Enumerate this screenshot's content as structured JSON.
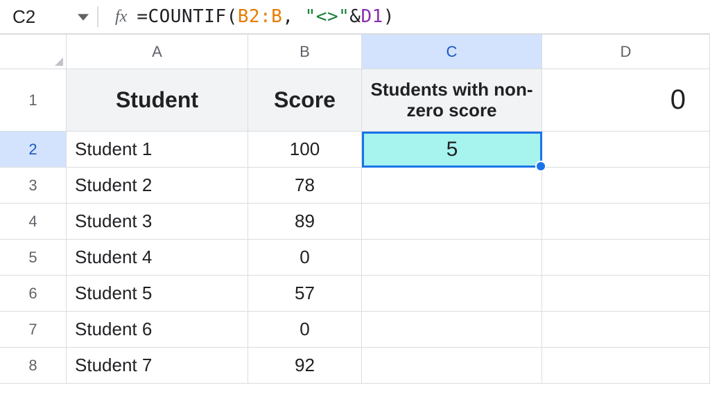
{
  "namebox": {
    "ref": "C2"
  },
  "formula": {
    "raw": "=COUNTIF(B2:B, \"<>\"&D1)",
    "fn": "COUNTIF",
    "range": "B2:B",
    "str": "\"<>\"",
    "amp": "&",
    "ref": "D1"
  },
  "columns": [
    "A",
    "B",
    "C",
    "D"
  ],
  "headers": {
    "A": "Student",
    "B": "Score",
    "C": "Students with non-zero score",
    "D": "0"
  },
  "active": {
    "cell": "C2",
    "value": "5"
  },
  "rows": [
    {
      "n": "2",
      "a": "Student 1",
      "b": "100"
    },
    {
      "n": "3",
      "a": "Student 2",
      "b": "78"
    },
    {
      "n": "4",
      "a": "Student 3",
      "b": "89"
    },
    {
      "n": "5",
      "a": "Student 4",
      "b": "0"
    },
    {
      "n": "6",
      "a": "Student 5",
      "b": "57"
    },
    {
      "n": "7",
      "a": "Student 6",
      "b": "0"
    },
    {
      "n": "8",
      "a": "Student 7",
      "b": "92"
    }
  ],
  "chart_data": {
    "type": "table",
    "title": "Students with non-zero score",
    "columns": [
      "Student",
      "Score"
    ],
    "rows": [
      [
        "Student 1",
        100
      ],
      [
        "Student 2",
        78
      ],
      [
        "Student 3",
        89
      ],
      [
        "Student 4",
        0
      ],
      [
        "Student 5",
        57
      ],
      [
        "Student 6",
        0
      ],
      [
        "Student 7",
        92
      ]
    ],
    "computed": {
      "label": "Students with non-zero score",
      "value": 5,
      "threshold_ref": "D1",
      "threshold_value": 0
    }
  }
}
